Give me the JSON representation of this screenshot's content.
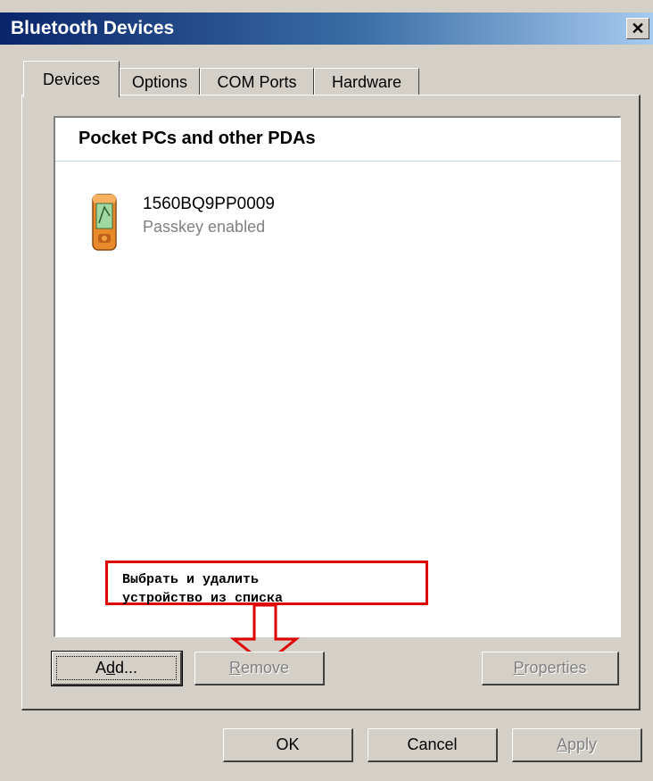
{
  "window": {
    "title": "Bluetooth Devices",
    "close_label": "✕"
  },
  "tabs": [
    {
      "label": "Devices",
      "active": true
    },
    {
      "label": "Options",
      "active": false
    },
    {
      "label": "COM Ports",
      "active": false
    },
    {
      "label": "Hardware",
      "active": false
    }
  ],
  "device_list": {
    "group_header": "Pocket PCs and other PDAs",
    "items": [
      {
        "name": "1560BQ9PP0009",
        "status": "Passkey enabled",
        "icon": "pda-icon"
      }
    ]
  },
  "annotation": {
    "text_line1": "Выбрать и удалить",
    "text_line2": "устройство из списка",
    "color": "#e00000"
  },
  "panel_buttons": {
    "add": {
      "before": "A",
      "accel": "d",
      "after": "d...",
      "enabled": true
    },
    "remove": {
      "accel": "R",
      "after": "emove",
      "enabled": false
    },
    "properties": {
      "accel": "P",
      "after": "roperties",
      "enabled": false
    }
  },
  "dialog_buttons": {
    "ok": "OK",
    "cancel": "Cancel",
    "apply": {
      "accel": "A",
      "after": "pply",
      "enabled": false
    }
  }
}
